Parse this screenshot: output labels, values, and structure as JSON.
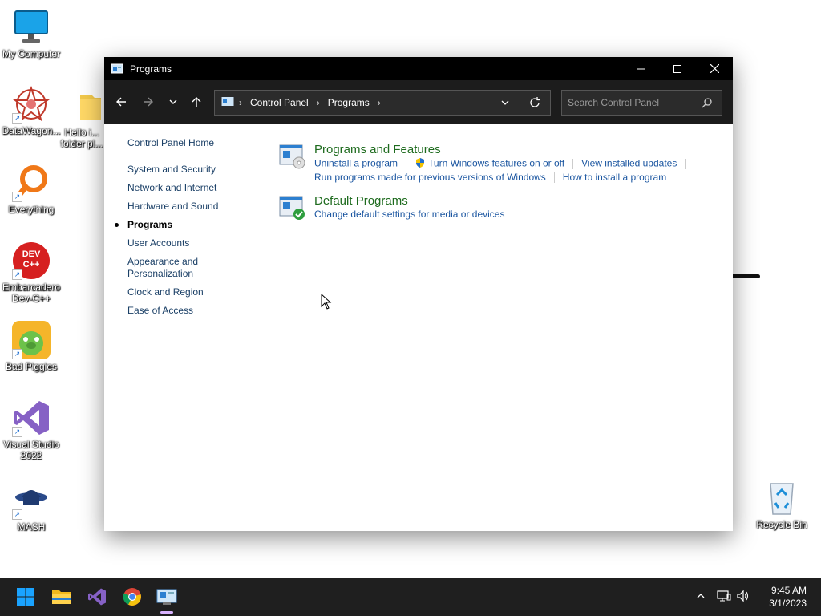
{
  "desktop": {
    "icons": [
      {
        "label": "My Computer"
      },
      {
        "label": "DataWagon..."
      },
      {
        "label": "Hello i..."
      },
      {
        "label": "folder pl..."
      },
      {
        "label": "Everything"
      },
      {
        "label": "Embarcadero Dev-C++"
      },
      {
        "label": "Bad Piggies"
      },
      {
        "label": "Visual Studio 2022"
      },
      {
        "label": "MASH"
      },
      {
        "label": "Recycle Bin"
      }
    ],
    "devcpp_badge": "DEV C++"
  },
  "window": {
    "title": "Programs",
    "address": {
      "crumbs": [
        "Control Panel",
        "Programs"
      ],
      "separator": "›"
    },
    "search_placeholder": "Search Control Panel",
    "left_pane": {
      "home": "Control Panel Home",
      "items": [
        "System and Security",
        "Network and Internet",
        "Hardware and Sound",
        "Programs",
        "User Accounts",
        "Appearance and Personalization",
        "Clock and Region",
        "Ease of Access"
      ],
      "current": "Programs"
    },
    "categories": [
      {
        "title": "Programs and Features",
        "row1": [
          "Uninstall a program",
          "Turn Windows features on or off",
          "View installed updates"
        ],
        "row2": [
          "Run programs made for previous versions of Windows",
          "How to install a program"
        ]
      },
      {
        "title": "Default Programs",
        "row1": [
          "Change default settings for media or devices"
        ]
      }
    ]
  },
  "taskbar": {
    "apps": [
      "start-icon",
      "file-explorer-icon",
      "visual-studio-icon",
      "chrome-icon",
      "control-panel-icon"
    ],
    "time": "9:45 AM",
    "date": "3/1/2023"
  },
  "colors": {
    "titlebar": "#000000",
    "navbar": "#1c1c1c",
    "category_title": "#1e6b1e",
    "link": "#1a55a0",
    "taskbar": "#1f1f1f"
  }
}
